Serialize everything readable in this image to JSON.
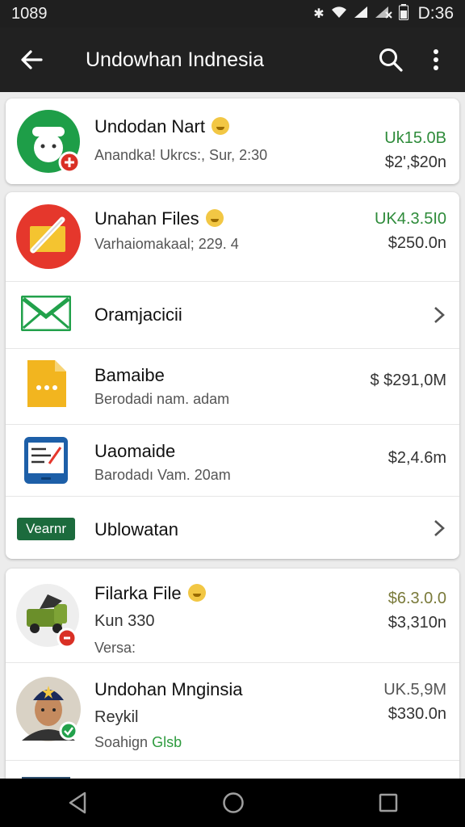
{
  "status": {
    "left_time": "1089",
    "clock": "D:36"
  },
  "appbar": {
    "title": "Undowhan Indnesia"
  },
  "card1": {
    "title": "Undodan Nart",
    "subtitle": "Anandka! Ukrcs:, Sur, 2:30",
    "amount_top": "Uk15.0B",
    "amount_bottom": "$2',$20n"
  },
  "card2": {
    "header": {
      "title": "Unahan Files",
      "subtitle": "Varhaiomakaal; 229. 4",
      "amount_top": "UK4.3.5I0",
      "amount_bottom": "$250.0n"
    },
    "items": [
      {
        "label": "Oramjacicii"
      },
      {
        "label": "Bamaibe",
        "sub": "Berodadi nam. adam",
        "price": "$  $291,0M"
      },
      {
        "label": "Uaomaide",
        "sub": "Barodadı Vam. 20am",
        "price": "$2,4.6m"
      },
      {
        "badge": "Vearnr",
        "label": "Ublowatan"
      }
    ]
  },
  "card3": {
    "row1": {
      "title": "Filarka File",
      "line2": "Kun 330",
      "line3": "Versa:",
      "amount_top": "$6.3.0.0",
      "amount_bottom": "$3,310n"
    },
    "row2": {
      "title": "Undohan Mnginsia",
      "line2": "Reykil",
      "line3_a": "Soahign",
      "line3_b": "Glsb",
      "amount_top": "UK.5,9M",
      "amount_bottom": "$330.0n"
    }
  },
  "colors": {
    "appbar": "#212121",
    "green": "#2e8b3a",
    "card_bg": "#ffffff",
    "screen_bg": "#ececec"
  }
}
